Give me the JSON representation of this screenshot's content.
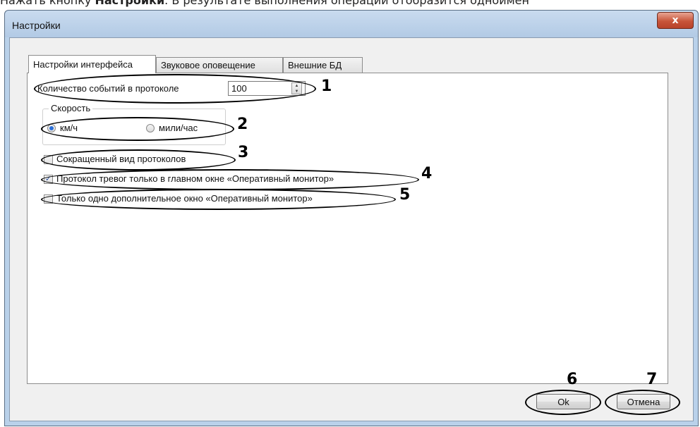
{
  "document": {
    "text_before": "Нажать кнопку ",
    "bold": "Настройки",
    "text_after": ". В результате выполнения операции отобразится одноимен"
  },
  "window": {
    "title": "Настройки",
    "close_label": "x"
  },
  "tabs": [
    {
      "label": "Настройки интерфейса",
      "active": true
    },
    {
      "label": "Звуковое оповещение",
      "active": false
    },
    {
      "label": "Внешние БД",
      "active": false
    }
  ],
  "settings": {
    "events_label": "Количество событий в протоколе",
    "events_value": "100",
    "speed_group_label": "Скорость",
    "speed_options": [
      {
        "label": "км/ч",
        "selected": true
      },
      {
        "label": "мили/час",
        "selected": false
      }
    ],
    "short_protocol": {
      "label": "Сокращенный вид протоколов",
      "checked": false
    },
    "alarm_main_only": {
      "label": "Протокол тревог только в главном окне «Оперативный монитор»",
      "checked": true
    },
    "single_extra_window": {
      "label": "Только одно дополнительное окно «Оперативный монитор»",
      "checked": false
    }
  },
  "buttons": {
    "ok": "Ok",
    "cancel": "Отмена"
  },
  "callouts": [
    "1",
    "2",
    "3",
    "4",
    "5",
    "6",
    "7"
  ]
}
